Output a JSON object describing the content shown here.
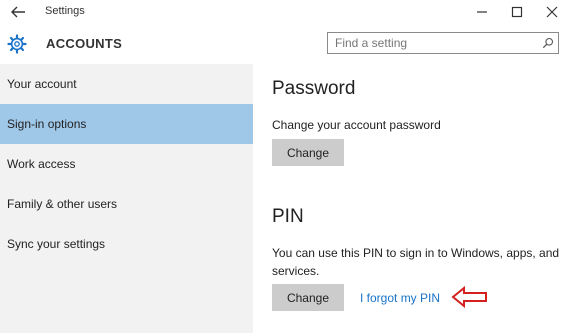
{
  "window": {
    "title": "Settings",
    "back_icon": "back-arrow-icon",
    "controls": [
      "minimize-icon",
      "maximize-icon",
      "close-icon"
    ]
  },
  "header": {
    "icon": "gear-icon",
    "title": "ACCOUNTS",
    "search": {
      "placeholder": "Find a setting",
      "value": "",
      "icon": "search-icon"
    }
  },
  "sidebar": {
    "items": [
      {
        "label": "Your account",
        "selected": false
      },
      {
        "label": "Sign-in options",
        "selected": true
      },
      {
        "label": "Work access",
        "selected": false
      },
      {
        "label": "Family & other users",
        "selected": false
      },
      {
        "label": "Sync your settings",
        "selected": false
      }
    ]
  },
  "content": {
    "password": {
      "title": "Password",
      "description": "Change your account password",
      "button": "Change"
    },
    "pin": {
      "title": "PIN",
      "description": "You can use this PIN to sign in to Windows, apps, and services.",
      "button": "Change",
      "link": "I forgot my PIN"
    }
  },
  "colors": {
    "accent": "#1a73c8",
    "selected_item": "#9fc7e8",
    "sidebar_bg": "#f2f2f2",
    "button_bg": "#cccccc",
    "annotation": "#d42020"
  }
}
